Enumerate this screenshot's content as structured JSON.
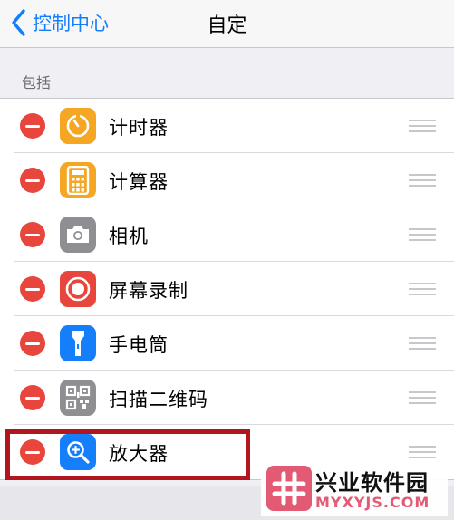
{
  "nav": {
    "back_label": "控制中心",
    "back_icon": "chevron-left-icon",
    "title": "自定"
  },
  "section": {
    "header": "包括",
    "items": [
      {
        "label": "计时器",
        "icon": "timer-icon",
        "icon_color": "#f5a623"
      },
      {
        "label": "计算器",
        "icon": "calculator-icon",
        "icon_color": "#f5a623"
      },
      {
        "label": "相机",
        "icon": "camera-icon",
        "icon_color": "#8e8e93"
      },
      {
        "label": "屏幕录制",
        "icon": "screen-record-icon",
        "icon_color": "#e8453c"
      },
      {
        "label": "手电筒",
        "icon": "flashlight-icon",
        "icon_color": "#147efb"
      },
      {
        "label": "扫描二维码",
        "icon": "qr-code-icon",
        "icon_color": "#8e8e93"
      },
      {
        "label": "放大器",
        "icon": "magnifier-icon",
        "icon_color": "#147efb"
      }
    ]
  },
  "colors": {
    "accent": "#147efb",
    "remove_button": "#e8453c",
    "highlight_box": "#b0161c"
  },
  "watermark": {
    "title": "兴业软件园",
    "url": "MYXYJS.COM"
  }
}
